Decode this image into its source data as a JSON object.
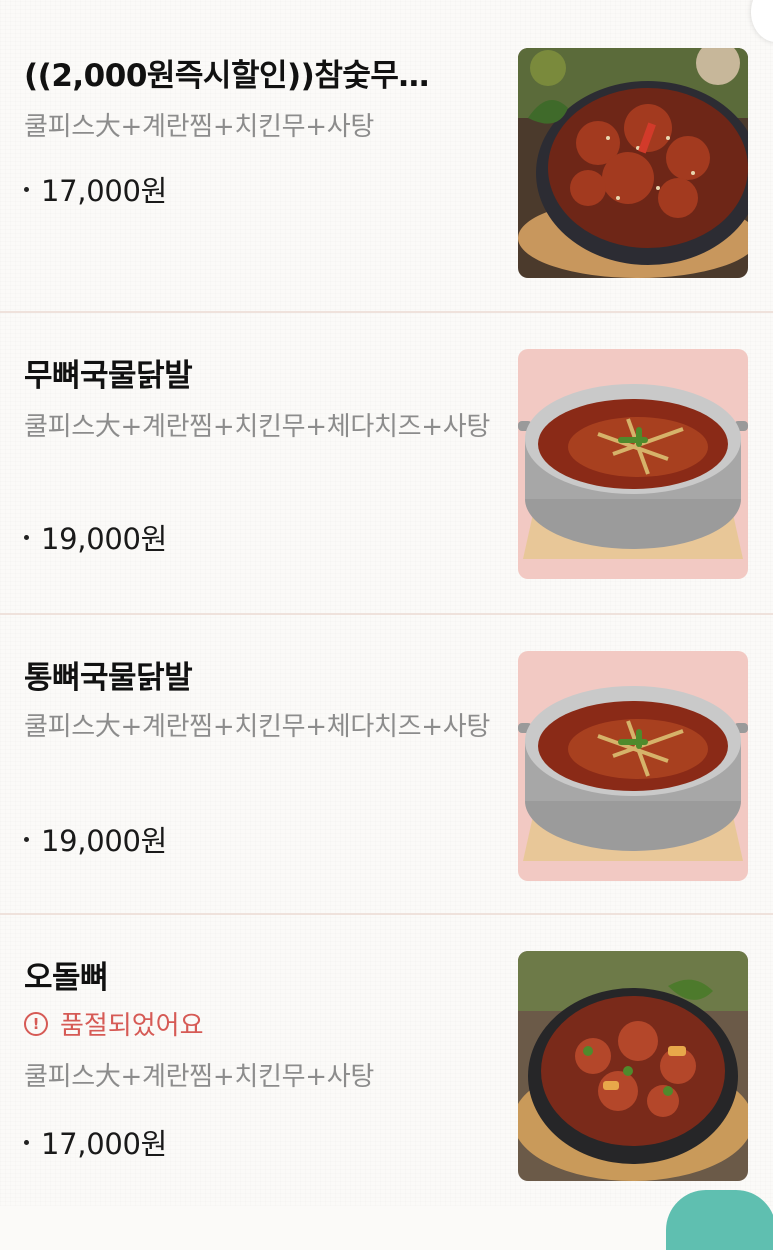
{
  "menu": {
    "items": [
      {
        "name": "((2,000원즉시할인))참숯무…",
        "desc": "쿨피스大+계란찜+치킨무+사탕",
        "price": "17,000원",
        "sold_out": false,
        "image_icon": "grilled-chicken-feet-on-wooden-plate"
      },
      {
        "name": "무뼈국물닭발",
        "desc": "쿨피스大+계란찜+치킨무+체다치즈+사탕",
        "price": "19,000원",
        "sold_out": false,
        "image_icon": "chicken-feet-soup-pot"
      },
      {
        "name": "통뼈국물닭발",
        "desc": "쿨피스大+계란찜+치킨무+체다치즈+사탕",
        "price": "19,000원",
        "sold_out": false,
        "image_icon": "chicken-feet-soup-pot"
      },
      {
        "name": "오돌뼈",
        "status": "품절되었어요",
        "desc": "쿨피스大+계란찜+치킨무+사탕",
        "price": "17,000원",
        "sold_out": true,
        "image_icon": "spicy-cartilage-on-iron-plate"
      }
    ]
  },
  "colors": {
    "soldout_red": "#d65a55",
    "divider": "#efe2dc",
    "desc_gray": "#8c8c8c",
    "fab_teal": "#5fbfb0"
  }
}
